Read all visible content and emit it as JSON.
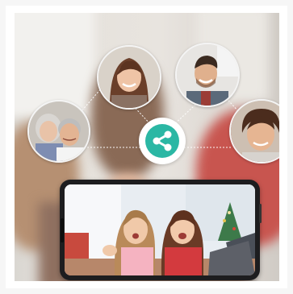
{
  "image": {
    "kind": "photo-collage",
    "palette": {
      "accent": "#2bb7a4",
      "line": "#ffffff",
      "frame": "#1d1d1f",
      "bubble_border": "#f4f4f4"
    },
    "icons": {
      "center": "share-icon"
    },
    "avatars": [
      {
        "subject": "elderly-couple"
      },
      {
        "subject": "woman-smiling"
      },
      {
        "subject": "young-man-smiling"
      },
      {
        "subject": "boy-smiling"
      }
    ],
    "phone": {
      "subject": "two-girls-video-call"
    }
  }
}
